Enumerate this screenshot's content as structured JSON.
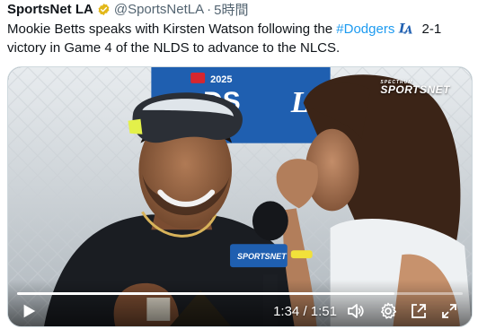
{
  "tweet": {
    "author_name": "SportsNet LA",
    "handle": "@SportsNetLA",
    "separator": "·",
    "time": "5時間",
    "text_before": "Mookie Betts speaks with Kirsten Watson following the ",
    "hashtag": "#Dodgers",
    "text_after": " 2-1 victory in Game 4 of the NLDS to advance to the NLCS."
  },
  "media": {
    "overlay_logo_small": "SPECTRUM",
    "overlay_logo": "SPORTSNET",
    "backdrop_year": "2025",
    "backdrop_text": "DS",
    "mic_flag": "SPORTSNET",
    "current_time": "1:34",
    "time_separator": " / ",
    "duration": "1:51",
    "progress_fraction": 0.847
  },
  "icons": {
    "verified": "verified-badge-icon",
    "team_logo": "dodgers-la-icon",
    "play": "play-icon",
    "volume": "volume-icon",
    "settings": "gear-icon",
    "popout": "popout-icon",
    "fullscreen": "fullscreen-icon"
  },
  "colors": {
    "hashtag": "#1d9bf0",
    "verified_gold": "#e2b719",
    "dodger_blue": "#1f5fb0",
    "muted_text": "#536471"
  }
}
